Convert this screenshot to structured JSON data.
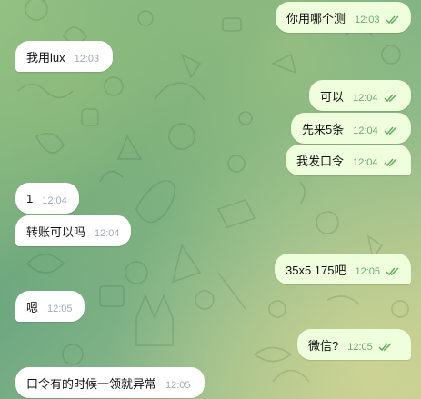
{
  "colors": {
    "incoming_bubble": "#ffffff",
    "outgoing_bubble": "#effedd",
    "outgoing_time": "#6aab6a",
    "incoming_time": "#a0acb6"
  },
  "messages": [
    {
      "direction": "out",
      "text": "你用哪个测",
      "time": "12:03",
      "status": "read-double-check-icon"
    },
    {
      "direction": "in",
      "text": "我用lux",
      "time": "12:03"
    },
    {
      "direction": "out",
      "text": "可以",
      "time": "12:04",
      "status": "read-double-check-icon"
    },
    {
      "direction": "out",
      "text": "先来5条",
      "time": "12:04",
      "status": "read-double-check-icon"
    },
    {
      "direction": "out",
      "text": "我发口令",
      "time": "12:04",
      "status": "read-double-check-icon"
    },
    {
      "direction": "in",
      "text": "1",
      "time": "12:04"
    },
    {
      "direction": "in",
      "text": "转账可以吗",
      "time": "12:04"
    },
    {
      "direction": "out",
      "text": "35x5 175吧",
      "time": "12:05",
      "status": "read-double-check-icon"
    },
    {
      "direction": "in",
      "text": "嗯",
      "time": "12:05"
    },
    {
      "direction": "out",
      "text": "微信?",
      "time": "12:05",
      "status": "read-double-check-icon"
    },
    {
      "direction": "in",
      "text": "口令有的时候一领就异常",
      "time": "12:05"
    }
  ]
}
